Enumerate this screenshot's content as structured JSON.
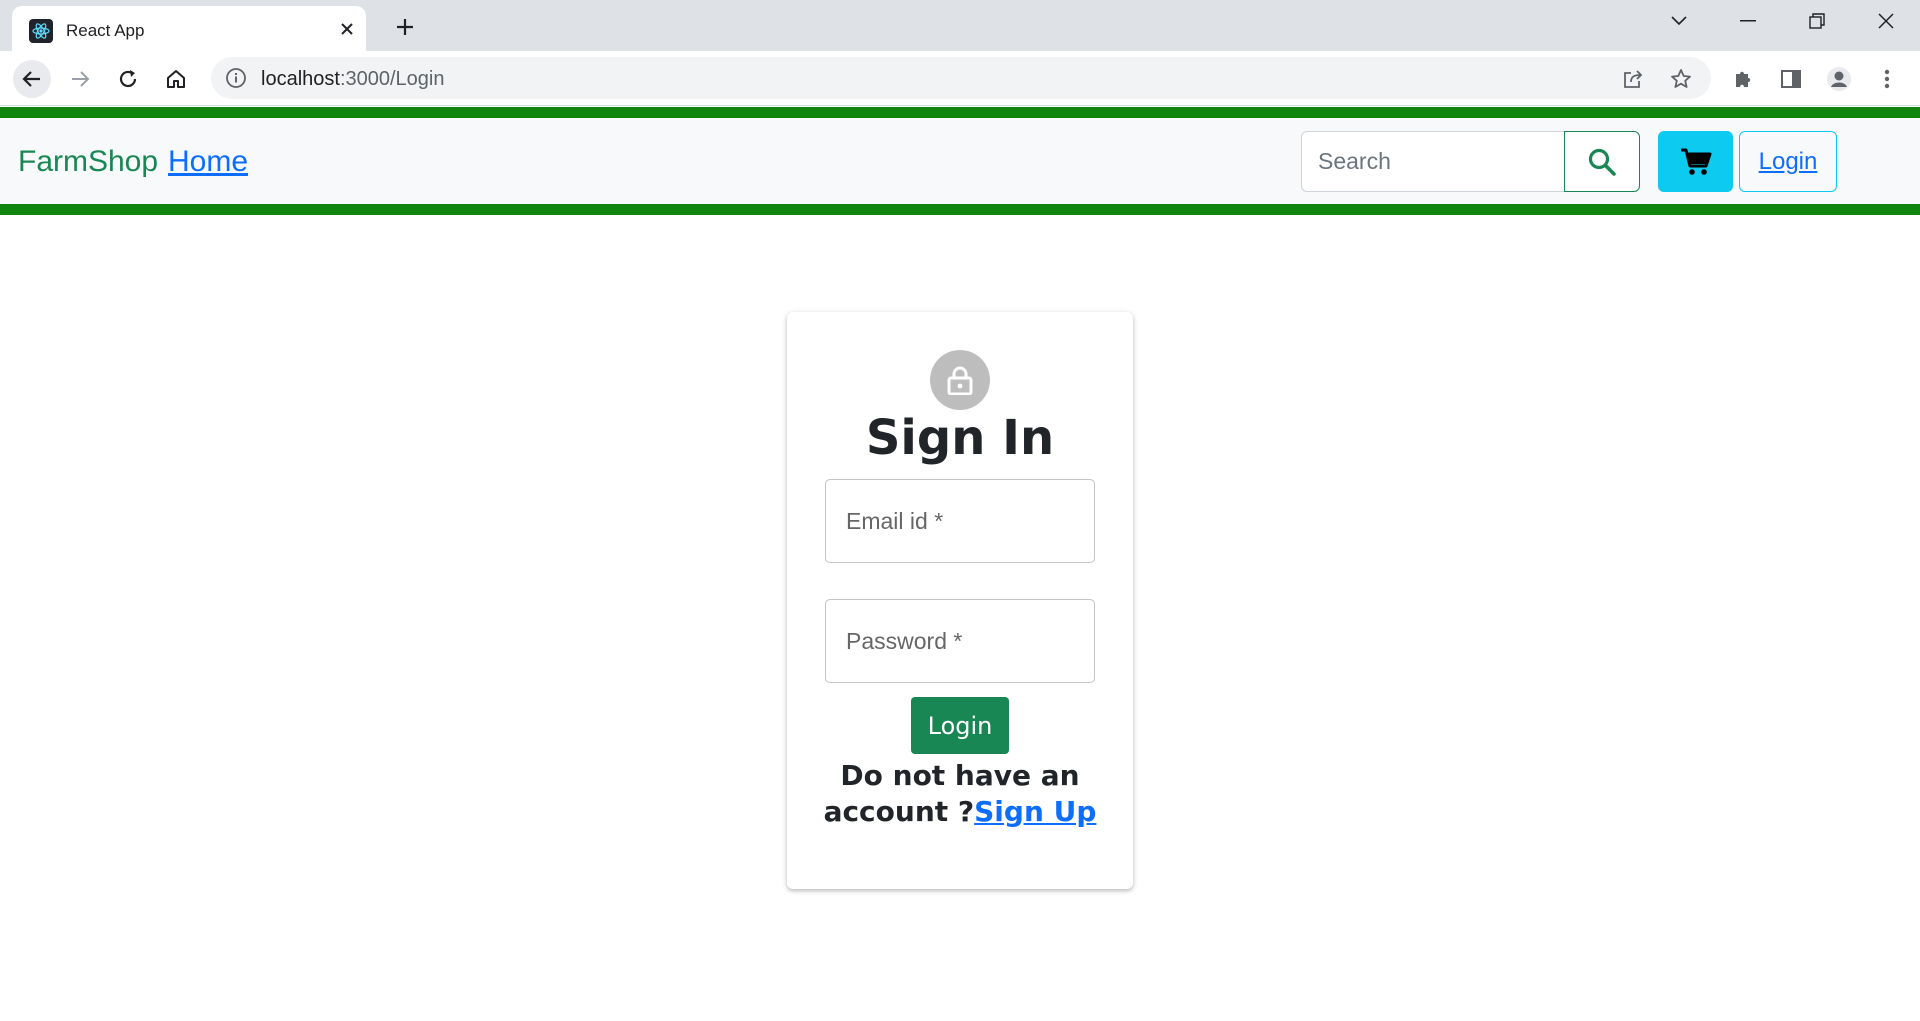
{
  "browser": {
    "tab_title": "React App",
    "url_host": "localhost",
    "url_path": ":3000/Login"
  },
  "navbar": {
    "brand": "FarmShop",
    "home_link": "Home",
    "search_placeholder": "Search",
    "login_button": "Login"
  },
  "signin_card": {
    "title": "Sign In",
    "email_placeholder": "Email id *",
    "password_placeholder": "Password *",
    "login_button": "Login",
    "no_account_text": "Do not have an account ?",
    "signup_link": "Sign Up"
  },
  "colors": {
    "navbar_border": "#11860f",
    "brand": "#198754",
    "link": "#0d6efd",
    "cart_button": "#0dcaf0",
    "login_button": "#198754"
  }
}
